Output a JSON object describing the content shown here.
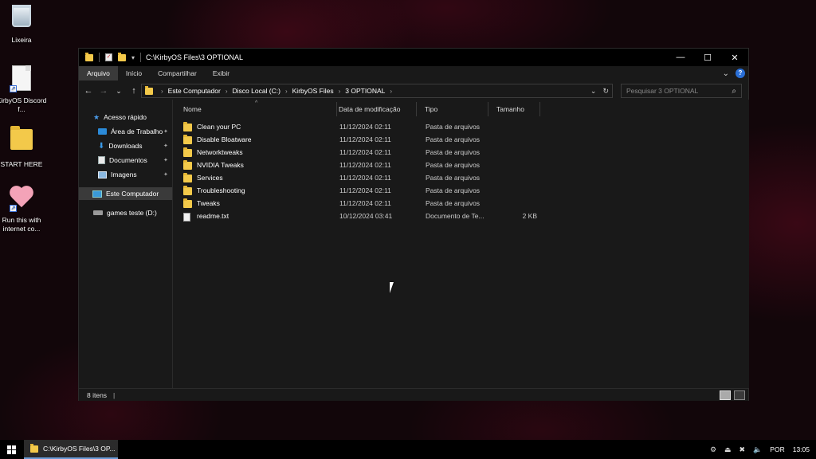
{
  "desktop": {
    "icons": [
      {
        "label": "Lixeira",
        "icon": "recycle-bin-icon"
      },
      {
        "label": "KirbyOS Discord f...",
        "icon": "document-shortcut-icon"
      },
      {
        "label": "START HERE",
        "icon": "folder-icon"
      },
      {
        "label": "Run this with internet co...",
        "icon": "heart-shortcut-icon"
      }
    ]
  },
  "window": {
    "title": "C:\\KirbyOS Files\\3 OPTIONAL",
    "controls": {
      "minimize": "—",
      "maximize": "☐",
      "close": "✕"
    }
  },
  "ribbon": {
    "tabs": [
      "Arquivo",
      "Início",
      "Compartilhar",
      "Exibir"
    ],
    "active_tab": "Arquivo",
    "expand": "⌄",
    "help": "?"
  },
  "navbar": {
    "back": "←",
    "forward": "→",
    "recent": "⌄",
    "up": "↑",
    "breadcrumbs": [
      "Este Computador",
      "Disco Local (C:)",
      "KirbyOS Files",
      "3 OPTIONAL"
    ],
    "dropdown": "⌄",
    "refresh": "↻",
    "search_placeholder": "Pesquisar 3 OPTIONAL"
  },
  "nav_pane": {
    "quick_access": "Acesso rápido",
    "items": [
      {
        "label": "Área de Trabalho",
        "pinned": true
      },
      {
        "label": "Downloads",
        "pinned": true
      },
      {
        "label": "Documentos",
        "pinned": true
      },
      {
        "label": "Imagens",
        "pinned": true
      }
    ],
    "this_pc": "Este Computador",
    "drive": "games teste (D:)",
    "pin_glyph": "📌"
  },
  "columns": {
    "name": "Nome",
    "date": "Data de modificação",
    "type": "Tipo",
    "size": "Tamanho"
  },
  "files": [
    {
      "name": "Clean your PC",
      "date": "11/12/2024 02:11",
      "type": "Pasta de arquivos",
      "size": "",
      "kind": "folder"
    },
    {
      "name": "Disable Bloatware",
      "date": "11/12/2024 02:11",
      "type": "Pasta de arquivos",
      "size": "",
      "kind": "folder"
    },
    {
      "name": "Networktweaks",
      "date": "11/12/2024 02:11",
      "type": "Pasta de arquivos",
      "size": "",
      "kind": "folder"
    },
    {
      "name": "NVIDIA Tweaks",
      "date": "11/12/2024 02:11",
      "type": "Pasta de arquivos",
      "size": "",
      "kind": "folder"
    },
    {
      "name": "Services",
      "date": "11/12/2024 02:11",
      "type": "Pasta de arquivos",
      "size": "",
      "kind": "folder"
    },
    {
      "name": "Troubleshooting",
      "date": "11/12/2024 02:11",
      "type": "Pasta de arquivos",
      "size": "",
      "kind": "folder"
    },
    {
      "name": "Tweaks",
      "date": "11/12/2024 02:11",
      "type": "Pasta de arquivos",
      "size": "",
      "kind": "folder"
    },
    {
      "name": "readme.txt",
      "date": "10/12/2024 03:41",
      "type": "Documento de Te...",
      "size": "2 KB",
      "kind": "text"
    }
  ],
  "status": {
    "item_count": "8 itens"
  },
  "taskbar": {
    "active_window": "C:\\KirbyOS Files\\3 OP...",
    "language": "POR",
    "time": "13:05"
  }
}
